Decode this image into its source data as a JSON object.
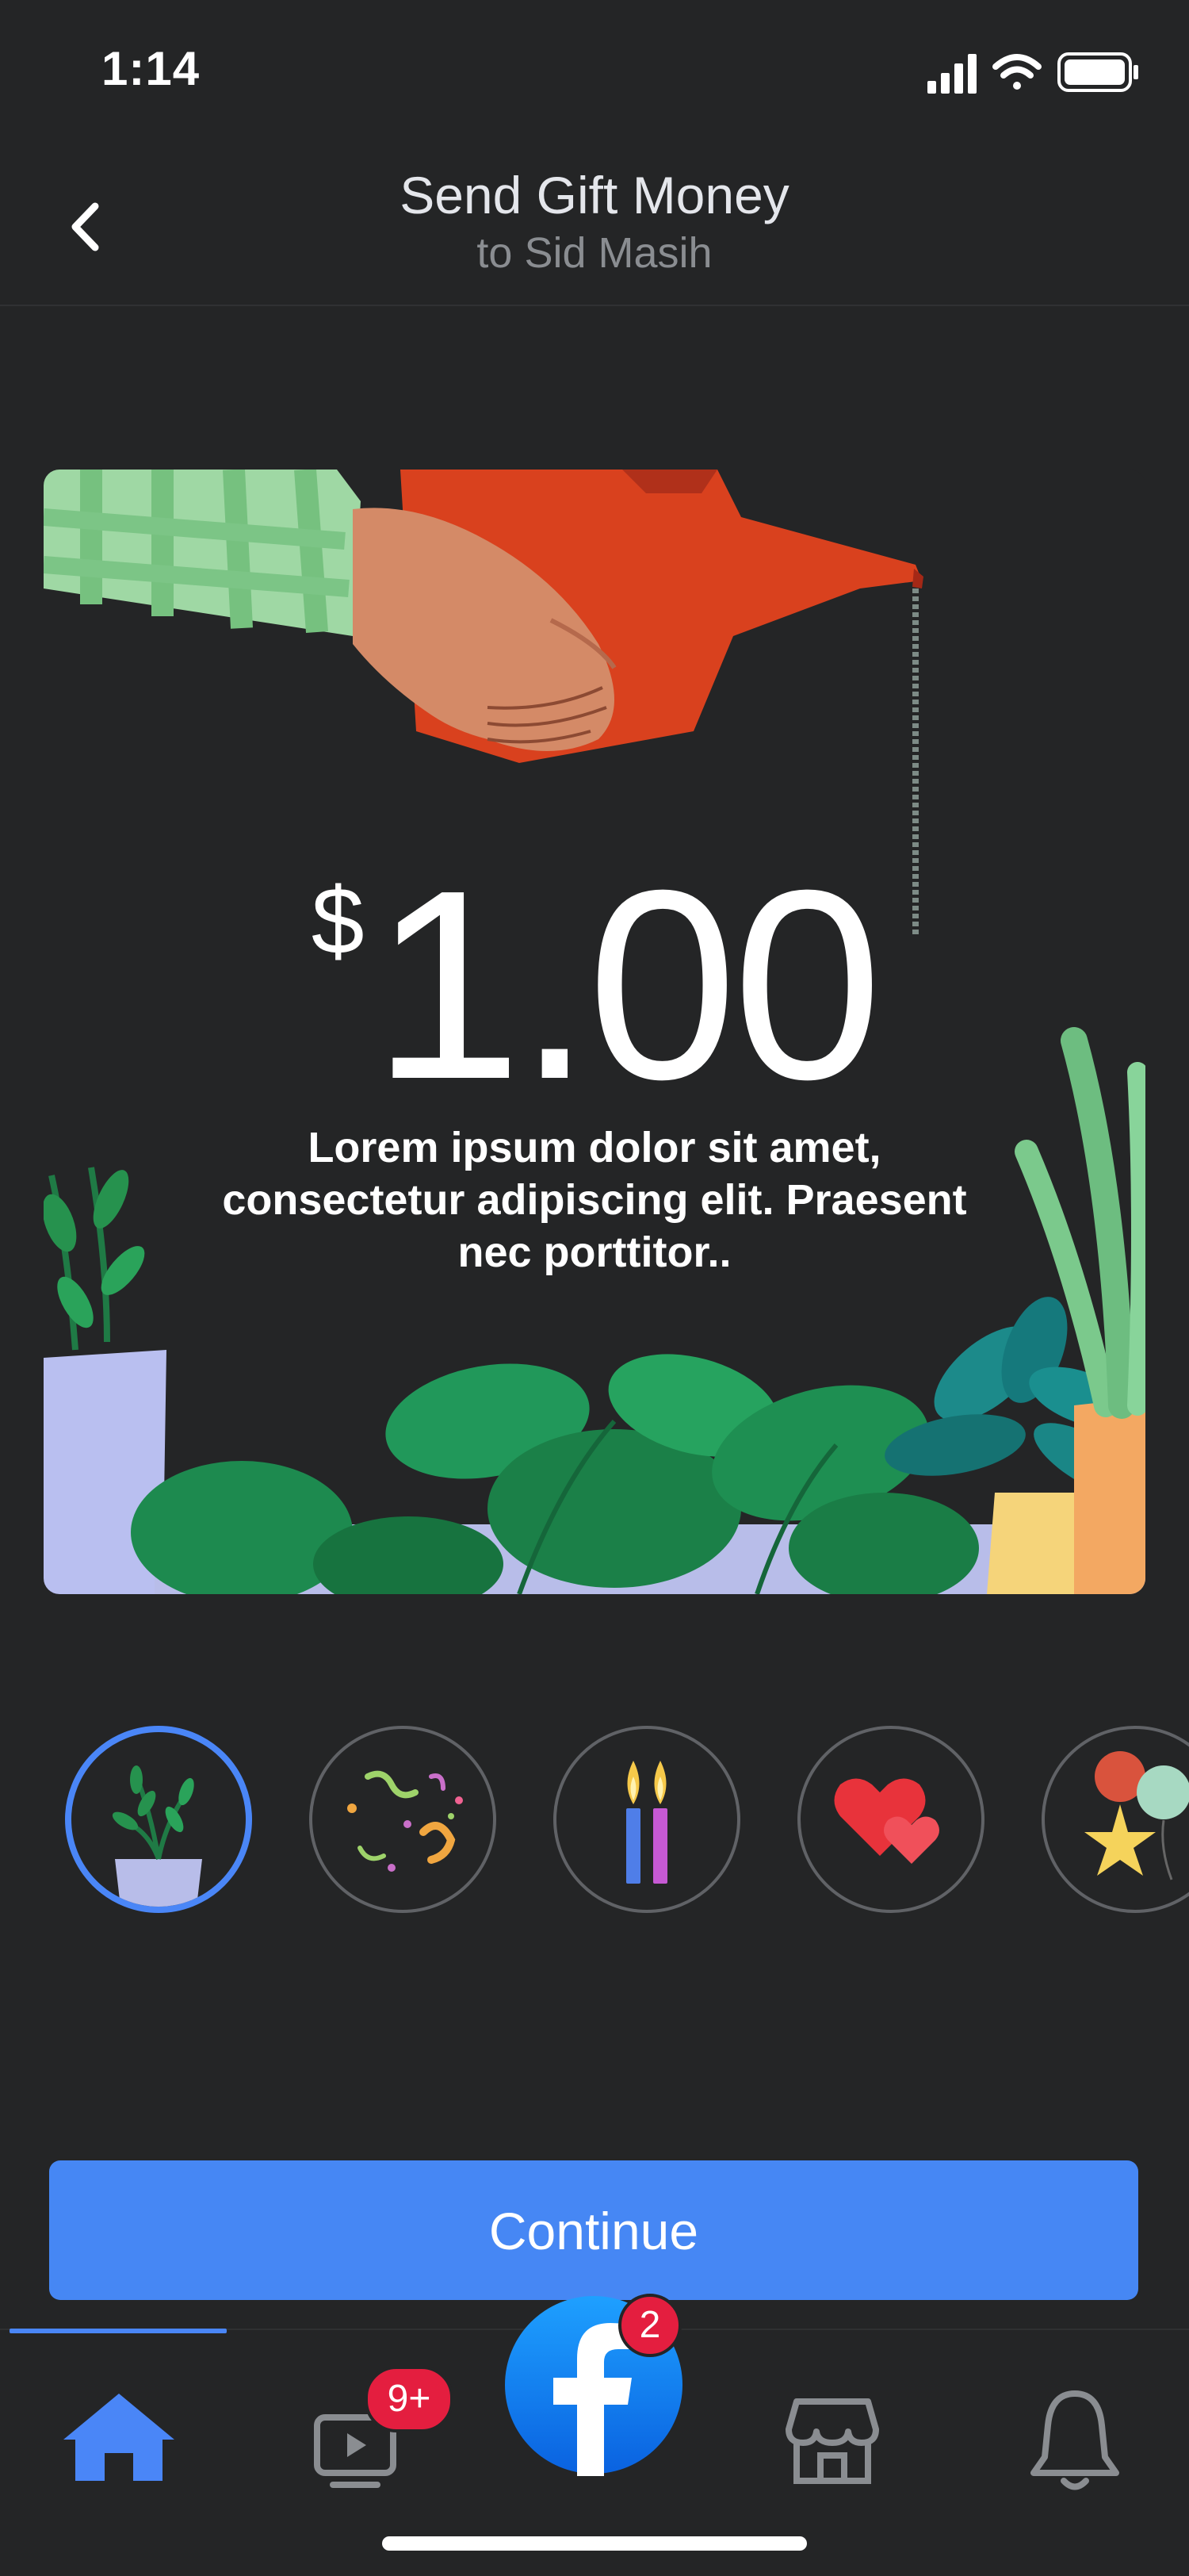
{
  "status_bar": {
    "time": "1:14"
  },
  "header": {
    "title": "Send Gift Money",
    "subtitle": "to Sid Masih"
  },
  "gift": {
    "currency": "$",
    "amount": "1.00",
    "message": "Lorem ipsum dolor sit amet, consectetur adipiscing elit. Praesent nec porttitor.."
  },
  "themes": [
    {
      "icon": "plant-icon",
      "selected": true
    },
    {
      "icon": "confetti-icon",
      "selected": false
    },
    {
      "icon": "candles-icon",
      "selected": false
    },
    {
      "icon": "hearts-icon",
      "selected": false
    },
    {
      "icon": "balloons-icon",
      "selected": false
    }
  ],
  "actions": {
    "continue_label": "Continue"
  },
  "tab_bar": {
    "tabs": [
      "home-icon",
      "video-icon",
      "facebook-icon",
      "marketplace-icon",
      "bell-icon"
    ],
    "video_badge": "9+",
    "facebook_badge": "2"
  },
  "colors": {
    "accent": "#4687f4",
    "background": "#242526",
    "badge": "#e41e3f"
  }
}
